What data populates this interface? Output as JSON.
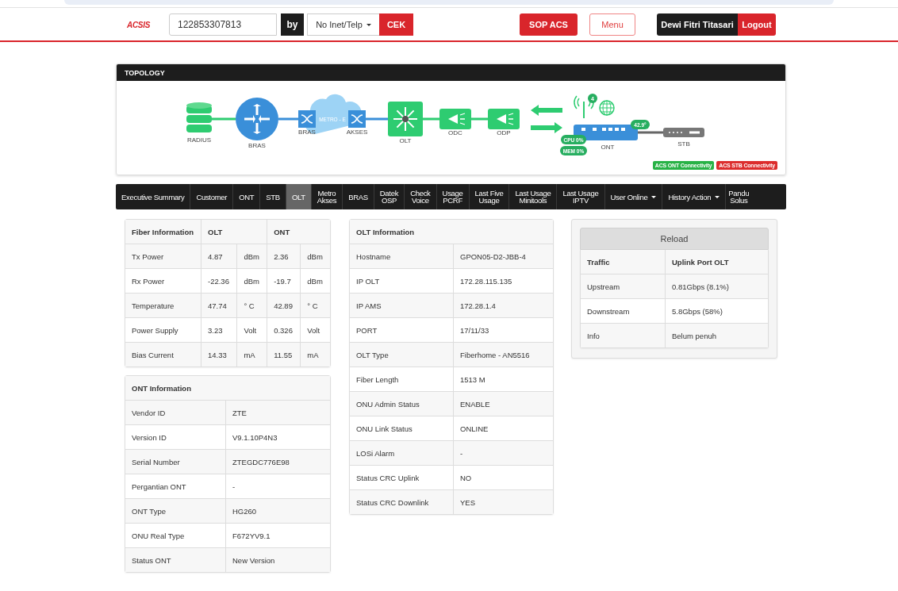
{
  "header": {
    "logo": "ACSIS",
    "search_value": "122853307813",
    "by_label": "by",
    "search_by": "No Inet/Telp",
    "check_button": "CEK",
    "sop_button": "SOP ACS",
    "menu_button": "Menu",
    "user_name": "Dewi Fitri Titasari",
    "logout_button": "Logout"
  },
  "topology": {
    "title": "TOPOLOGY",
    "nodes": [
      {
        "kind": "database",
        "label": "RADIUS"
      },
      {
        "kind": "router",
        "label": "BRAS"
      },
      {
        "kind": "switch",
        "label": "BRAS"
      },
      {
        "kind": "cloud",
        "label": "METRO - E"
      },
      {
        "kind": "switch",
        "label": "AKSES"
      },
      {
        "kind": "olt",
        "label": "OLT"
      },
      {
        "kind": "splitter",
        "label": "ODC"
      },
      {
        "kind": "splitter",
        "label": "ODP"
      },
      {
        "kind": "ont",
        "label": "ONT"
      },
      {
        "kind": "stb",
        "label": "STB"
      }
    ],
    "ont_stats": {
      "wifi_clients": "4",
      "temperature": "42.9°",
      "cpu": "CPU 0%",
      "memory": "MEM 0%"
    },
    "badges": [
      {
        "label": "ACS ONT Connectivity",
        "color": "#28b246"
      },
      {
        "label": "ACS STB Connectivity",
        "color": "#dc2d2d"
      }
    ]
  },
  "tabs": [
    {
      "label": "Executive Summary",
      "selected": false,
      "dropdown": false
    },
    {
      "label": "Customer",
      "selected": false,
      "dropdown": false
    },
    {
      "label": "ONT",
      "selected": false,
      "dropdown": false
    },
    {
      "label": "STB",
      "selected": false,
      "dropdown": false
    },
    {
      "label": "OLT",
      "selected": true,
      "dropdown": false
    },
    {
      "label": "Metro\nAkses",
      "selected": false,
      "dropdown": false
    },
    {
      "label": "BRAS",
      "selected": false,
      "dropdown": false
    },
    {
      "label": "Datek\nOSP",
      "selected": false,
      "dropdown": false
    },
    {
      "label": "Check\nVoice",
      "selected": false,
      "dropdown": false
    },
    {
      "label": "Usage\nPCRF",
      "selected": false,
      "dropdown": false
    },
    {
      "label": "Last Five\nUsage",
      "selected": false,
      "dropdown": false
    },
    {
      "label": "Last Usage\nMinitools",
      "selected": false,
      "dropdown": false
    },
    {
      "label": "Last Usage\nIPTV",
      "selected": false,
      "dropdown": false
    },
    {
      "label": "User Online",
      "selected": false,
      "dropdown": true
    },
    {
      "label": "History Action",
      "selected": false,
      "dropdown": true
    },
    {
      "label": "Pandu\nSolus",
      "selected": false,
      "dropdown": false
    }
  ],
  "fiber_information": {
    "columns": [
      "Fiber Information",
      "OLT",
      "ONT"
    ],
    "rows": [
      {
        "label": "Tx Power",
        "olt_value": "4.87",
        "olt_unit": "dBm",
        "ont_value": "2.36",
        "ont_unit": "dBm"
      },
      {
        "label": "Rx Power",
        "olt_value": "-22.36",
        "olt_unit": "dBm",
        "ont_value": "-19.7",
        "ont_unit": "dBm"
      },
      {
        "label": "Temperature",
        "olt_value": "47.74",
        "olt_unit": "° C",
        "ont_value": "42.89",
        "ont_unit": "° C"
      },
      {
        "label": "Power Supply",
        "olt_value": "3.23",
        "olt_unit": "Volt",
        "ont_value": "0.326",
        "ont_unit": "Volt"
      },
      {
        "label": "Bias Current",
        "olt_value": "14.33",
        "olt_unit": "mA",
        "ont_value": "11.55",
        "ont_unit": "mA"
      }
    ]
  },
  "ont_information": {
    "title": "ONT Information",
    "rows": [
      {
        "label": "Vendor ID",
        "value": "ZTE"
      },
      {
        "label": "Version ID",
        "value": "V9.1.10P4N3"
      },
      {
        "label": "Serial Number",
        "value": "ZTEGDC776E98"
      },
      {
        "label": "Pergantian ONT",
        "value": "-"
      },
      {
        "label": "ONT Type",
        "value": "HG260"
      },
      {
        "label": "ONU Real Type",
        "value": "F672YV9.1"
      },
      {
        "label": "Status ONT",
        "value": "New Version"
      }
    ]
  },
  "olt_information": {
    "title": "OLT Information",
    "rows": [
      {
        "label": "Hostname",
        "value": "GPON05-D2-JBB-4"
      },
      {
        "label": "IP OLT",
        "value": "172.28.115.135"
      },
      {
        "label": "IP AMS",
        "value": "172.28.1.4"
      },
      {
        "label": "PORT",
        "value": "17/11/33"
      },
      {
        "label": "OLT Type",
        "value": "Fiberhome - AN5516"
      },
      {
        "label": "Fiber Length",
        "value": "1513 M"
      },
      {
        "label": "ONU Admin Status",
        "value": "ENABLE"
      },
      {
        "label": "ONU Link Status",
        "value": "ONLINE"
      },
      {
        "label": "LOSi Alarm",
        "value": "-"
      },
      {
        "label": "Status CRC Uplink",
        "value": "NO"
      },
      {
        "label": "Status CRC Downlink",
        "value": "YES"
      }
    ]
  },
  "traffic": {
    "reload_button": "Reload",
    "columns": [
      "Traffic",
      "Uplink Port OLT"
    ],
    "rows": [
      {
        "label": "Upstream",
        "value": "0.81Gbps (8.1%)"
      },
      {
        "label": "Downstream",
        "value": "5.8Gbps (58%)"
      },
      {
        "label": "Info",
        "value": "Belum penuh"
      }
    ]
  }
}
